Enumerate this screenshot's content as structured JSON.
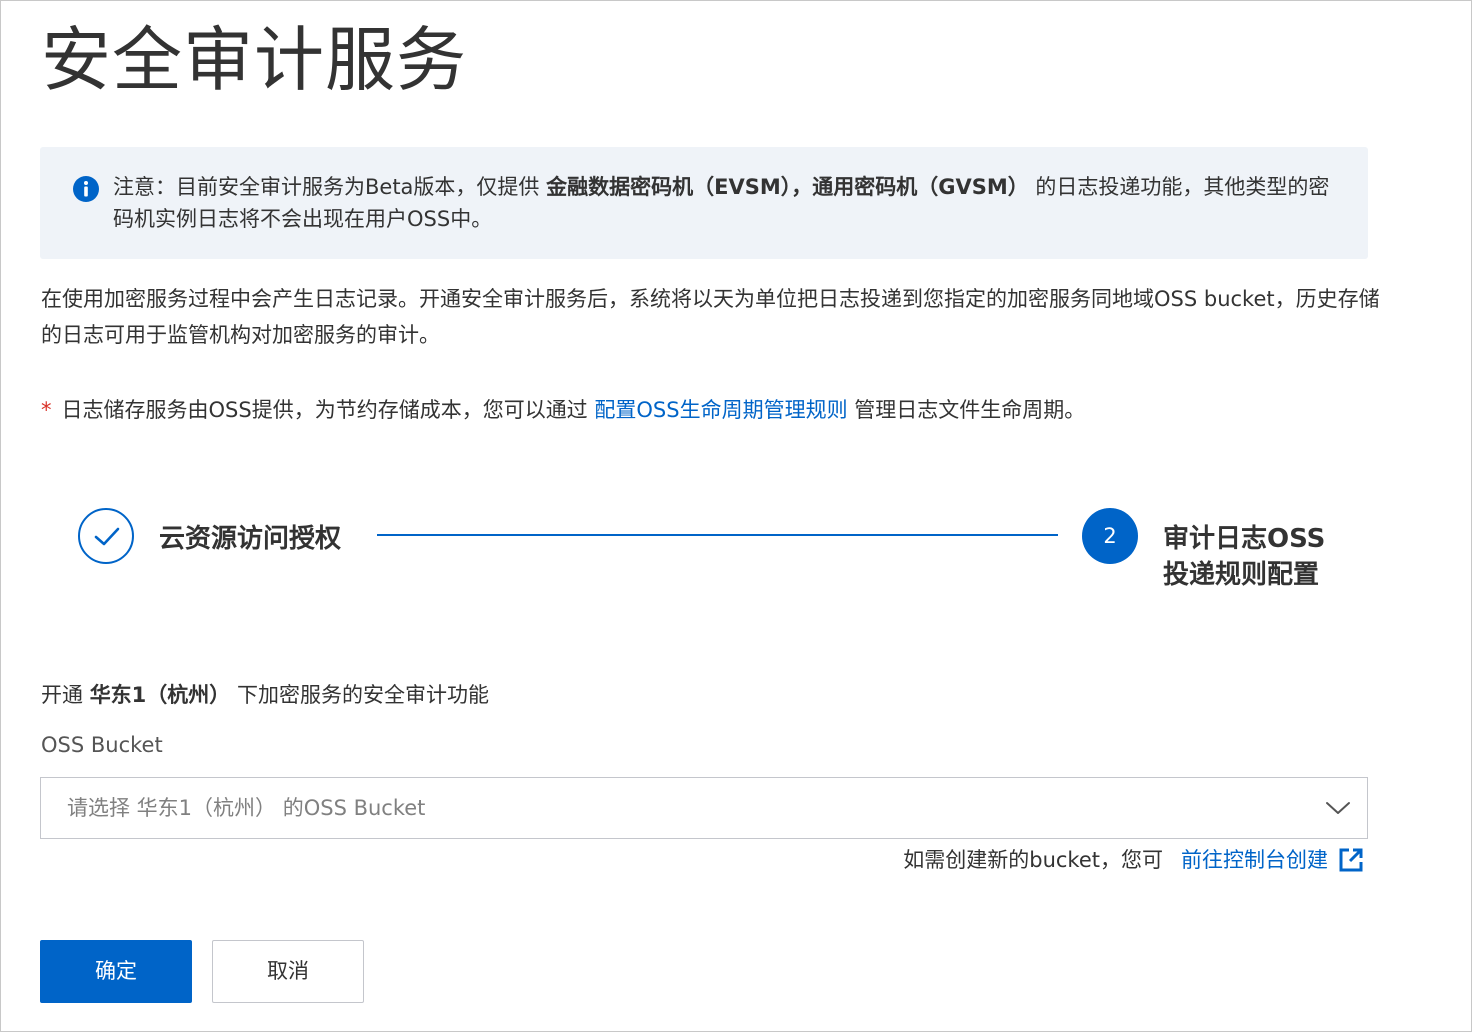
{
  "page": {
    "title": "安全审计服务"
  },
  "notice": {
    "icon": "info-icon",
    "prefix": "注意：目前安全审计服务为Beta版本，仅提供 ",
    "bold1": "金融数据密码机（EVSM），通用密码机（GVSM）",
    "suffix": " 的日志投递功能，其他类型的密码机实例日志将不会出现在用户OSS中。"
  },
  "description": "在使用加密服务过程中会产生日志记录。开通安全审计服务后，系统将以天为单位把日志投递到您指定的加密服务同地域OSS bucket，历史存储的日志可用于监管机构对加密服务的审计。",
  "storage_note": {
    "asterisk": "*",
    "prefix": "日志储存服务由OSS提供，为节约存储成本，您可以通过 ",
    "link": "配置OSS生命周期管理规则",
    "suffix": " 管理日志文件生命周期。"
  },
  "steps": [
    {
      "label": "云资源访问授权",
      "status": "done",
      "icon": "check-icon"
    },
    {
      "number": "2",
      "label": "审计日志OSS投递规则配置",
      "status": "active"
    }
  ],
  "form": {
    "region_prefix": "开通 ",
    "region": "华东1（杭州）",
    "region_suffix": " 下加密服务的安全审计功能",
    "bucket_label": "OSS Bucket",
    "bucket_placeholder": "请选择 华东1（杭州） 的OSS Bucket",
    "helper_text": "如需创建新的bucket，您可",
    "helper_link": "前往控制台创建"
  },
  "actions": {
    "confirm": "确定",
    "cancel": "取消"
  },
  "colors": {
    "primary": "#0064c8",
    "notice_bg": "#eff3f8",
    "required": "#d93026"
  }
}
